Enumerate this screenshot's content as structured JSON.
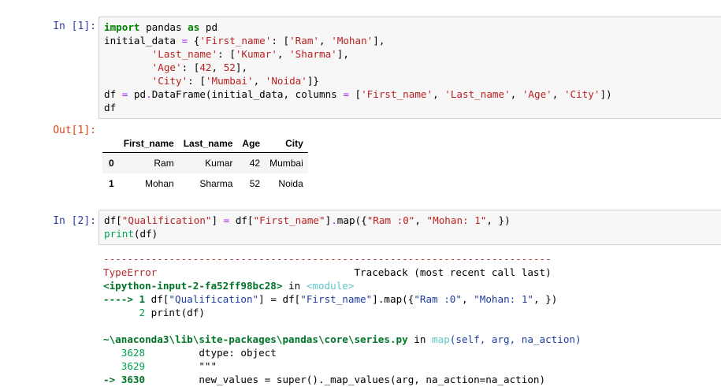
{
  "cell1": {
    "in_prompt": "In [1]:",
    "out_prompt": "Out[1]:",
    "code_lines": [
      [
        {
          "t": "import",
          "c": "kw"
        },
        {
          "t": " pandas ",
          "c": ""
        },
        {
          "t": "as",
          "c": "kw"
        },
        {
          "t": " pd",
          "c": ""
        }
      ],
      [
        {
          "t": "initial_data ",
          "c": ""
        },
        {
          "t": "=",
          "c": "op"
        },
        {
          "t": " {",
          "c": ""
        },
        {
          "t": "'First_name'",
          "c": "str"
        },
        {
          "t": ": [",
          "c": ""
        },
        {
          "t": "'Ram'",
          "c": "str"
        },
        {
          "t": ", ",
          "c": ""
        },
        {
          "t": "'Mohan'",
          "c": "str"
        },
        {
          "t": "],",
          "c": ""
        }
      ],
      [
        {
          "t": "        ",
          "c": ""
        },
        {
          "t": "'Last_name'",
          "c": "str"
        },
        {
          "t": ": [",
          "c": ""
        },
        {
          "t": "'Kumar'",
          "c": "str"
        },
        {
          "t": ", ",
          "c": ""
        },
        {
          "t": "'Sharma'",
          "c": "str"
        },
        {
          "t": "],",
          "c": ""
        }
      ],
      [
        {
          "t": "        ",
          "c": ""
        },
        {
          "t": "'Age'",
          "c": "str"
        },
        {
          "t": ": [",
          "c": ""
        },
        {
          "t": "42",
          "c": "str"
        },
        {
          "t": ", ",
          "c": ""
        },
        {
          "t": "52",
          "c": "str"
        },
        {
          "t": "],",
          "c": ""
        }
      ],
      [
        {
          "t": "        ",
          "c": ""
        },
        {
          "t": "'City'",
          "c": "str"
        },
        {
          "t": ": [",
          "c": ""
        },
        {
          "t": "'Mumbai'",
          "c": "str"
        },
        {
          "t": ", ",
          "c": ""
        },
        {
          "t": "'Noida'",
          "c": "str"
        },
        {
          "t": "]}",
          "c": ""
        }
      ],
      [
        {
          "t": "df ",
          "c": ""
        },
        {
          "t": "=",
          "c": "op"
        },
        {
          "t": " pd",
          "c": ""
        },
        {
          "t": ".",
          "c": "op"
        },
        {
          "t": "DataFrame(initial_data, columns ",
          "c": ""
        },
        {
          "t": "=",
          "c": "op"
        },
        {
          "t": " [",
          "c": ""
        },
        {
          "t": "'First_name'",
          "c": "str"
        },
        {
          "t": ", ",
          "c": ""
        },
        {
          "t": "'Last_name'",
          "c": "str"
        },
        {
          "t": ", ",
          "c": ""
        },
        {
          "t": "'Age'",
          "c": "str"
        },
        {
          "t": ", ",
          "c": ""
        },
        {
          "t": "'City'",
          "c": "str"
        },
        {
          "t": "])",
          "c": ""
        }
      ],
      [
        {
          "t": "df",
          "c": ""
        }
      ]
    ],
    "table": {
      "columns": [
        "",
        "First_name",
        "Last_name",
        "Age",
        "City"
      ],
      "rows": [
        {
          "index": "0",
          "cells": [
            "Ram",
            "Kumar",
            "42",
            "Mumbai"
          ]
        },
        {
          "index": "1",
          "cells": [
            "Mohan",
            "Sharma",
            "52",
            "Noida"
          ]
        }
      ]
    }
  },
  "cell2": {
    "in_prompt": "In [2]:",
    "code_lines": [
      [
        {
          "t": "df[",
          "c": ""
        },
        {
          "t": "\"Qualification\"",
          "c": "str"
        },
        {
          "t": "] ",
          "c": ""
        },
        {
          "t": "=",
          "c": "op"
        },
        {
          "t": " df[",
          "c": ""
        },
        {
          "t": "\"First_name\"",
          "c": "str"
        },
        {
          "t": "]",
          "c": ""
        },
        {
          "t": ".",
          "c": "op"
        },
        {
          "t": "map({",
          "c": ""
        },
        {
          "t": "\"Ram :0\"",
          "c": "str"
        },
        {
          "t": ", ",
          "c": ""
        },
        {
          "t": "\"Mohan: 1\"",
          "c": "str"
        },
        {
          "t": ", })",
          "c": ""
        }
      ],
      [
        {
          "t": "print",
          "c": "green"
        },
        {
          "t": "(df)",
          "c": ""
        }
      ]
    ],
    "traceback_lines": [
      [
        {
          "t": "---------------------------------------------------------------------------",
          "c": "dashes"
        }
      ],
      [
        {
          "t": "TypeError",
          "c": "red"
        },
        {
          "t": "                                 Traceback (most recent call last)",
          "c": ""
        }
      ],
      [
        {
          "t": "<ipython-input-2-fa52ff98bc28>",
          "c": "greenb"
        },
        {
          "t": " in ",
          "c": ""
        },
        {
          "t": "<module>",
          "c": "cyan"
        }
      ],
      [
        {
          "t": "----> 1",
          "c": "greenb"
        },
        {
          "t": " df[",
          "c": ""
        },
        {
          "t": "\"Qualification\"",
          "c": "darkblue"
        },
        {
          "t": "] = df[",
          "c": ""
        },
        {
          "t": "\"First_name\"",
          "c": "darkblue"
        },
        {
          "t": "].map({",
          "c": ""
        },
        {
          "t": "\"Ram :0\"",
          "c": "darkblue"
        },
        {
          "t": ", ",
          "c": ""
        },
        {
          "t": "\"Mohan: 1\"",
          "c": "darkblue"
        },
        {
          "t": ", })",
          "c": ""
        }
      ],
      [
        {
          "t": "      2",
          "c": "green"
        },
        {
          "t": " print(df)",
          "c": ""
        }
      ],
      [
        {
          "t": "",
          "c": ""
        }
      ],
      [
        {
          "t": "~\\anaconda3\\lib\\site-packages\\pandas\\core\\series.py",
          "c": "greenb"
        },
        {
          "t": " in ",
          "c": ""
        },
        {
          "t": "map",
          "c": "cyan"
        },
        {
          "t": "(self, arg, na_action)",
          "c": "darkblue"
        }
      ],
      [
        {
          "t": "   3628",
          "c": "green"
        },
        {
          "t": "         dtype: object",
          "c": ""
        }
      ],
      [
        {
          "t": "   3629",
          "c": "green"
        },
        {
          "t": "         \"\"\"",
          "c": ""
        }
      ],
      [
        {
          "t": "-> 3630",
          "c": "greenb"
        },
        {
          "t": "         new_values = super()._map_values(arg, na_action=na_action)",
          "c": ""
        }
      ]
    ]
  }
}
